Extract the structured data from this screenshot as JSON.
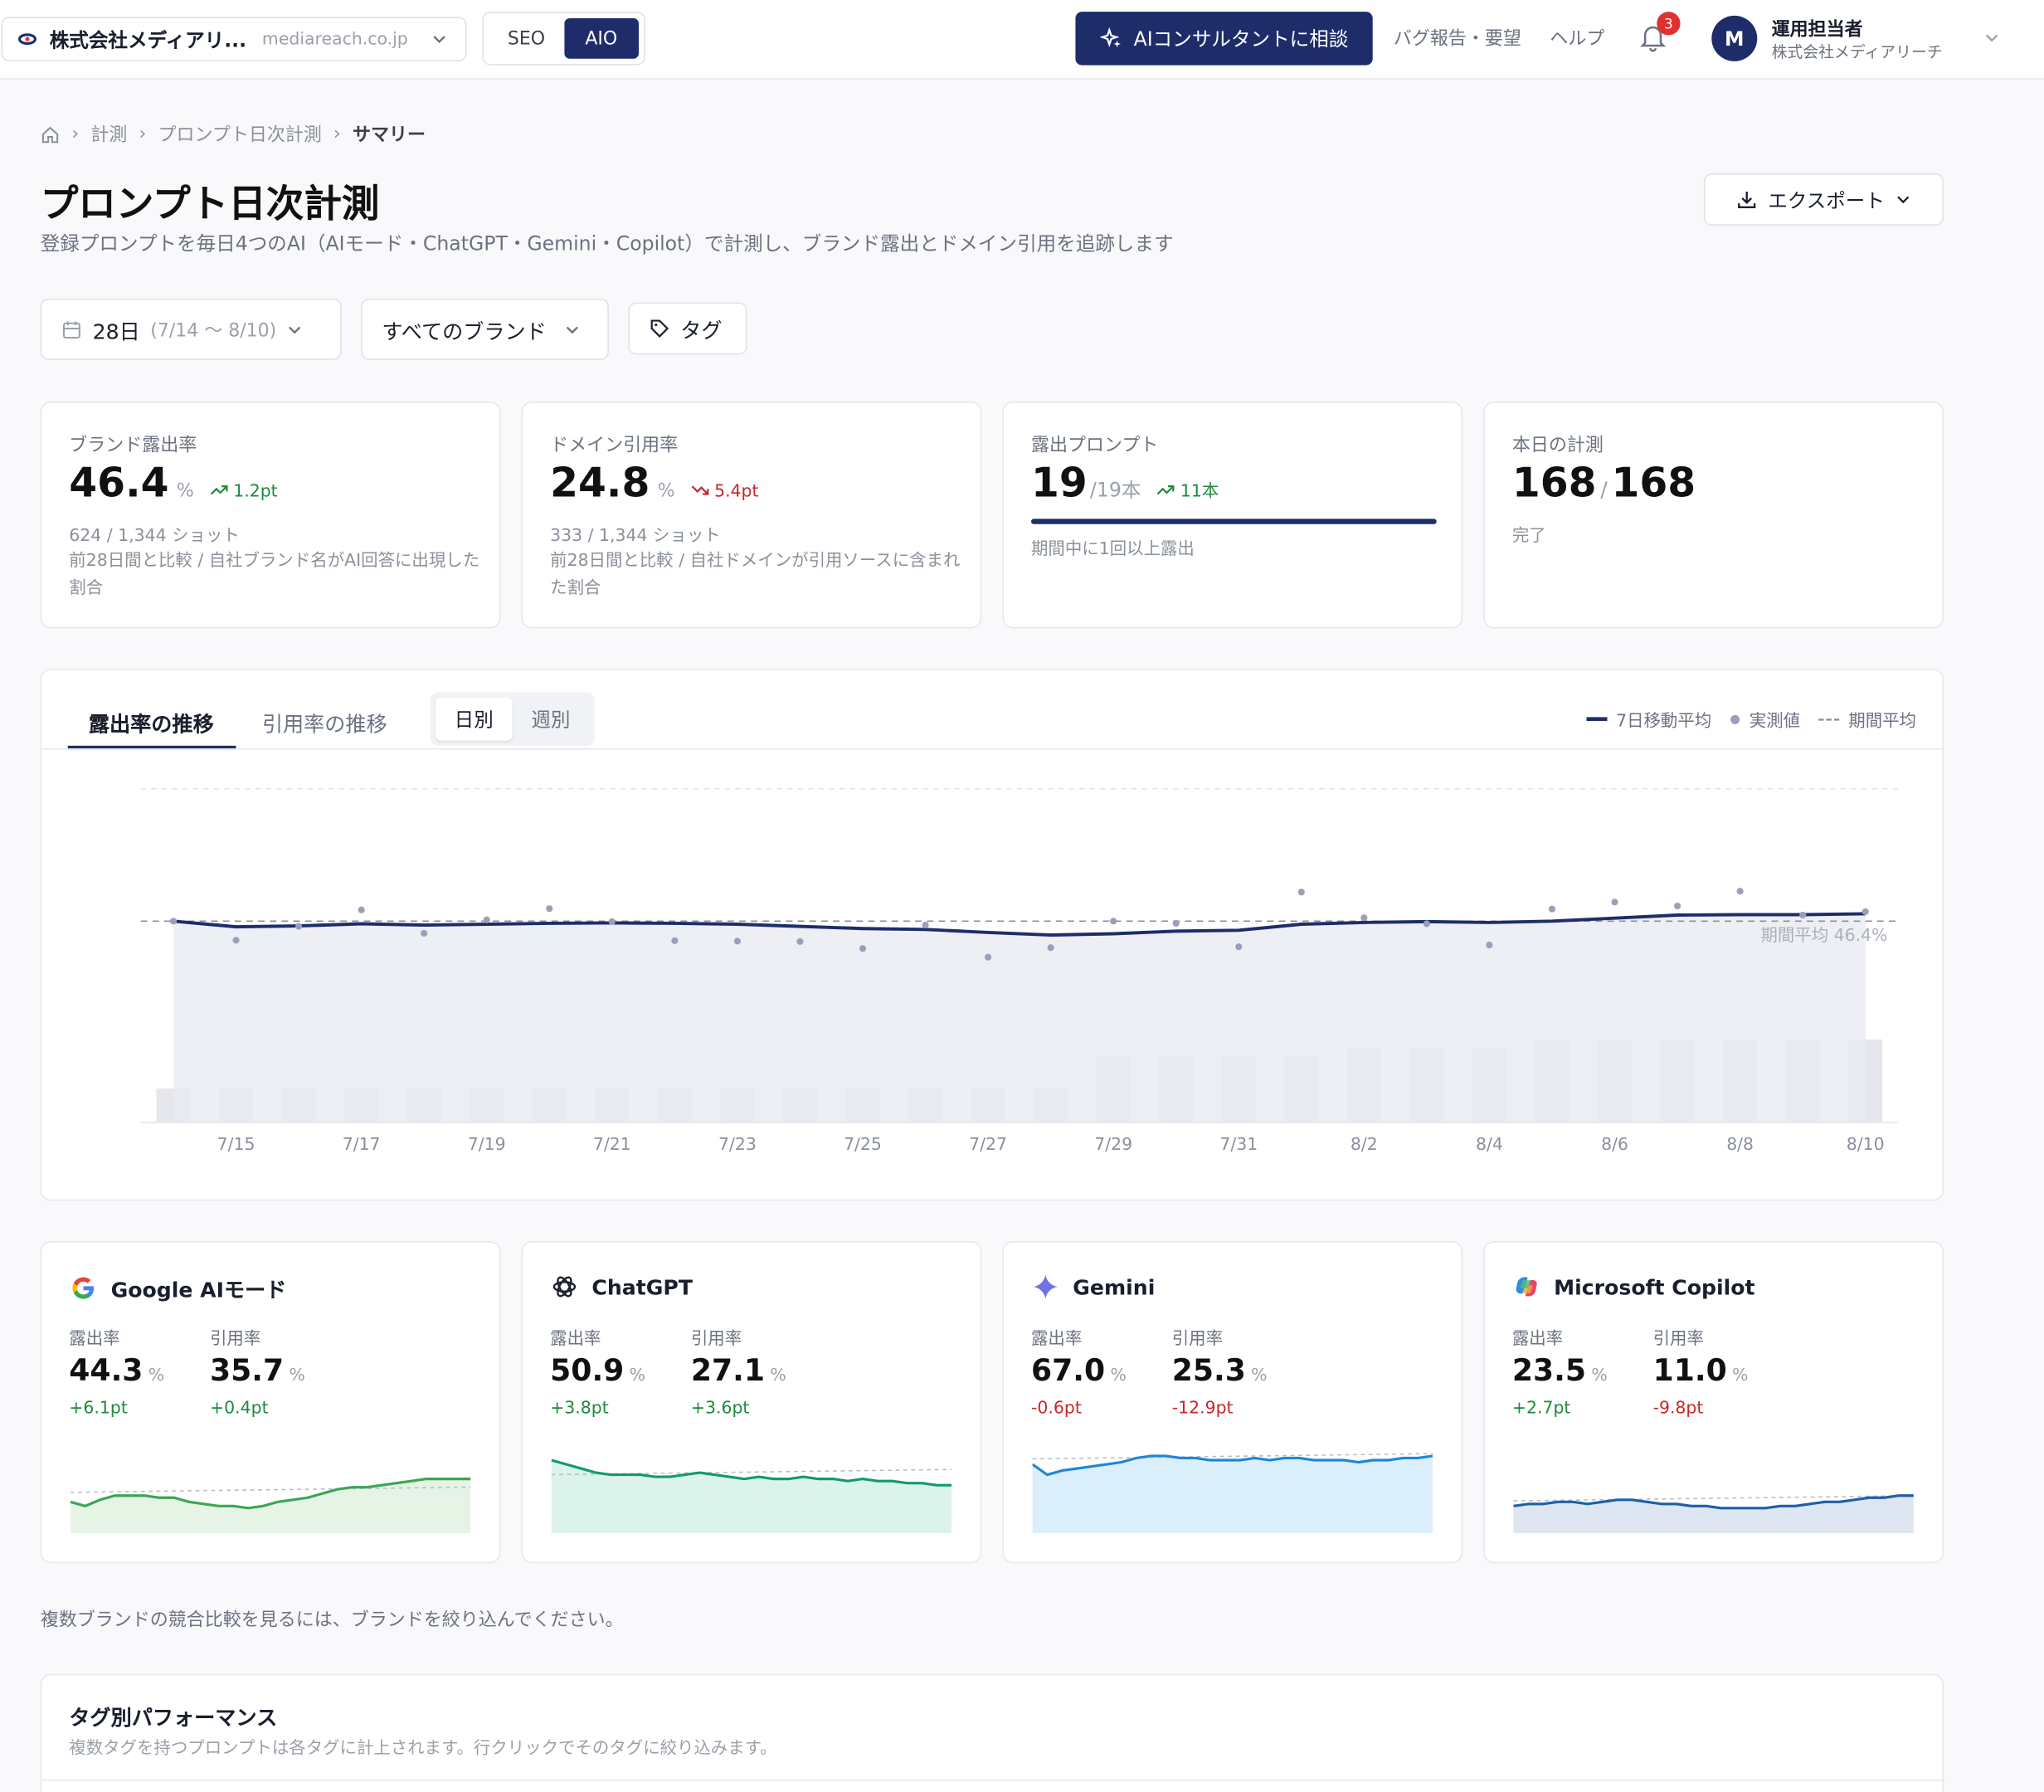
{
  "header": {
    "project_name": "株式会社メディアリ...",
    "project_domain": "mediareach.co.jp",
    "modes": [
      "SEO",
      "AIO"
    ],
    "active_mode": "AIO",
    "consult_label": "AIコンサルタントに相談",
    "bug_report_label": "バグ報告・要望",
    "help_label": "ヘルプ",
    "notification_count": "3",
    "avatar_initial": "M",
    "user_name": "運用担当者",
    "user_company": "株式会社メディアリーチ"
  },
  "breadcrumb": {
    "items": [
      "計測",
      "プロンプト日次計測"
    ],
    "current": "サマリー"
  },
  "page": {
    "title": "プロンプト日次計測",
    "subtitle": "登録プロンプトを毎日4つのAI（AIモード・ChatGPT・Gemini・Copilot）で計測し、ブランド露出とドメイン引用を追跡します",
    "export_label": "エクスポート"
  },
  "filters": {
    "period_label": "28日",
    "period_range": "(7/14 〜 8/10)",
    "brand_label": "すべてのブランド",
    "tag_label": "タグ"
  },
  "kpis": {
    "brand_exposure": {
      "label": "ブランド露出率",
      "value": "46.4",
      "unit": "%",
      "delta": "1.2pt",
      "sub1": "624 / 1,344 ショット",
      "sub2": "前28日間と比較 / 自社ブランド名がAI回答に出現した割合"
    },
    "domain_citation": {
      "label": "ドメイン引用率",
      "value": "24.8",
      "unit": "%",
      "delta": "5.4pt",
      "sub1": "333 / 1,344 ショット",
      "sub2": "前28日間と比較 / 自社ドメインが引用ソースに含まれた割合"
    },
    "exposed_prompts": {
      "label": "露出プロンプト",
      "value": "19",
      "unit": "/19本",
      "delta": "11本",
      "progress": 1.0,
      "sub1": "期間中に1回以上露出"
    },
    "today": {
      "label": "本日の計測",
      "value": "168",
      "sep": "/",
      "total": "168",
      "sub1": "完了"
    }
  },
  "trend": {
    "tabs": [
      "露出率の推移",
      "引用率の推移"
    ],
    "active_tab": "露出率の推移",
    "granularity": [
      "日別",
      "週別"
    ],
    "active_granularity": "日別",
    "legend": {
      "moving_avg": "7日移動平均",
      "actual": "実測値",
      "period_avg": "期間平均"
    },
    "avg_label": "期間平均 46.4%",
    "colors": {
      "line": "#1e2d6a",
      "area": "#e8e9f2",
      "dots": "#9aa0b8",
      "bars": "#e6e7ed"
    }
  },
  "chart_data": {
    "type": "line",
    "x": [
      "7/14",
      "7/15",
      "7/16",
      "7/17",
      "7/18",
      "7/19",
      "7/20",
      "7/21",
      "7/22",
      "7/23",
      "7/24",
      "7/25",
      "7/26",
      "7/27",
      "7/28",
      "7/29",
      "7/30",
      "7/31",
      "8/1",
      "8/2",
      "8/3",
      "8/4",
      "8/5",
      "8/6",
      "8/7",
      "8/8",
      "8/9",
      "8/10"
    ],
    "xticks": [
      "7/15",
      "7/17",
      "7/19",
      "7/21",
      "7/23",
      "7/25",
      "7/27",
      "7/29",
      "7/31",
      "8/2",
      "8/4",
      "8/6",
      "8/8",
      "8/10"
    ],
    "ylim": [
      0,
      100
    ],
    "period_average": 46.4,
    "series": [
      {
        "name": "7日移動平均",
        "values": [
          46.4,
          45.1,
          45.3,
          45.8,
          45.5,
          45.7,
          45.9,
          46.0,
          45.9,
          45.7,
          45.2,
          44.7,
          44.5,
          43.8,
          43.2,
          43.5,
          44.1,
          44.3,
          45.7,
          46.1,
          46.3,
          46.1,
          46.4,
          47.1,
          47.8,
          47.9,
          47.9,
          48.1
        ]
      },
      {
        "name": "実測値",
        "values": [
          46.4,
          42.0,
          45.2,
          49.0,
          43.6,
          46.7,
          49.3,
          46.3,
          41.9,
          41.8,
          41.7,
          40.1,
          45.5,
          38.1,
          40.3,
          46.4,
          45.9,
          40.5,
          53.1,
          47.2,
          45.8,
          40.9,
          49.2,
          50.8,
          49.9,
          53.3,
          47.8,
          48.6
        ]
      },
      {
        "name": "計測数",
        "values": [
          20,
          20,
          20,
          20,
          20,
          20,
          20,
          20,
          20,
          20,
          20,
          20,
          20,
          20,
          20,
          39,
          39,
          39,
          39,
          44,
          44,
          44,
          49,
          49,
          49,
          49,
          49,
          49
        ]
      }
    ]
  },
  "engines": [
    {
      "name": "Google AIモード",
      "icon": "google-icon",
      "exposure_label": "露出率",
      "exposure": "44.3",
      "exposure_delta": "+6.1pt",
      "citation_label": "引用率",
      "citation": "35.7",
      "citation_delta": "+0.4pt",
      "unit": "%",
      "color": "#3aa655",
      "fill": "#e6f4e6",
      "spark": [
        40,
        38,
        41,
        43,
        43,
        43,
        42,
        42,
        40,
        39,
        38,
        38,
        37,
        38,
        40,
        41,
        42,
        44,
        46,
        47,
        47,
        48,
        49,
        50,
        51,
        51,
        51,
        51
      ]
    },
    {
      "name": "ChatGPT",
      "icon": "chatgpt-icon",
      "exposure_label": "露出率",
      "exposure": "50.9",
      "exposure_delta": "+3.8pt",
      "citation_label": "引用率",
      "citation": "27.1",
      "citation_delta": "+3.6pt",
      "unit": "%",
      "color": "#129a6f",
      "fill": "#dcf3ec",
      "spark": [
        60,
        58,
        56,
        54,
        53,
        53,
        53,
        52,
        52,
        53,
        54,
        53,
        52,
        51,
        52,
        51,
        51,
        52,
        51,
        51,
        50,
        51,
        50,
        50,
        49,
        49,
        48,
        48
      ]
    },
    {
      "name": "Gemini",
      "icon": "gemini-icon",
      "exposure_label": "露出率",
      "exposure": "67.0",
      "exposure_delta": "-0.6pt",
      "citation_label": "引用率",
      "citation": "25.3",
      "citation_delta": "-12.9pt",
      "unit": "%",
      "color": "#1f86d6",
      "fill": "#dbeefc",
      "spark": [
        58,
        53,
        55,
        56,
        57,
        58,
        59,
        61,
        62,
        62,
        61,
        61,
        60,
        60,
        60,
        61,
        60,
        61,
        61,
        60,
        60,
        60,
        59,
        60,
        60,
        61,
        61,
        62
      ]
    },
    {
      "name": "Microsoft Copilot",
      "icon": "copilot-icon",
      "exposure_label": "露出率",
      "exposure": "23.5",
      "exposure_delta": "+2.7pt",
      "citation_label": "引用率",
      "citation": "11.0",
      "citation_delta": "-9.8pt",
      "unit": "%",
      "color": "#1e5fa8",
      "fill": "#dde6f1",
      "spark": [
        38,
        39,
        39,
        40,
        40,
        39,
        40,
        41,
        41,
        40,
        39,
        39,
        38,
        38,
        37,
        37,
        37,
        37,
        38,
        38,
        39,
        40,
        40,
        41,
        42,
        42,
        43,
        43
      ]
    }
  ],
  "note": "複数ブランドの競合比較を見るには、ブランドを絞り込んでください。",
  "tag_perf": {
    "title": "タグ別パフォーマンス",
    "subtitle": "複数タグを持つプロンプトは各タグに計上されます。行クリックでそのタグに絞り込みます。"
  }
}
